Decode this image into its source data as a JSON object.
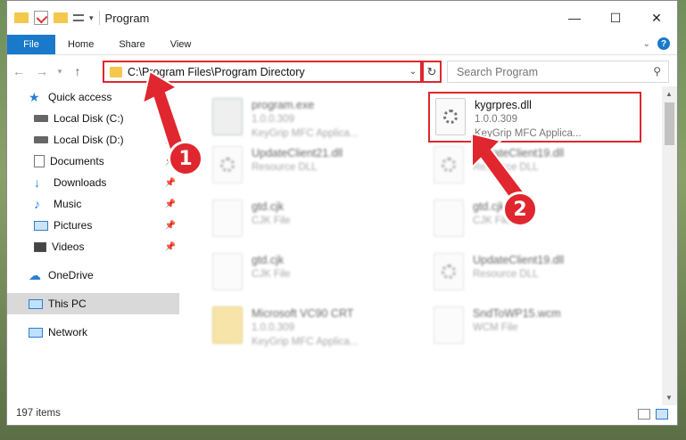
{
  "window": {
    "title": "Program",
    "minimize": "—",
    "maximize": "☐",
    "close": "✕"
  },
  "ribbon": {
    "tabs": [
      "File",
      "Home",
      "Share",
      "View"
    ],
    "help": "?"
  },
  "address": {
    "path": "C:\\Program Files\\Program Directory",
    "search_placeholder": "Search Program"
  },
  "sidebar": {
    "items": [
      {
        "label": "Quick access",
        "icon": "star-icon"
      },
      {
        "label": "Local Disk (C:)",
        "icon": "drive-icon"
      },
      {
        "label": "Local Disk (D:)",
        "icon": "drive-icon"
      },
      {
        "label": "Documents",
        "icon": "documents-icon"
      },
      {
        "label": "Downloads",
        "icon": "download-icon"
      },
      {
        "label": "Music",
        "icon": "music-icon"
      },
      {
        "label": "Pictures",
        "icon": "pictures-icon"
      },
      {
        "label": "Videos",
        "icon": "videos-icon"
      },
      {
        "label": "OneDrive",
        "icon": "cloud-icon"
      },
      {
        "label": "This PC",
        "icon": "computer-icon"
      },
      {
        "label": "Network",
        "icon": "network-icon"
      }
    ]
  },
  "files": [
    {
      "name": "program.exe",
      "line1": "1.0.0.309",
      "line2": "KeyGrip MFC Applica..."
    },
    {
      "name": "kygrpres.dll",
      "line1": "1.0.0.309",
      "line2": "KeyGrip MFC Applica..."
    },
    {
      "name": "UpdateClient21.dll",
      "line1": "Resource DLL",
      "line2": ""
    },
    {
      "name": "UpdateClient19.dll",
      "line1": "Resource DLL",
      "line2": ""
    },
    {
      "name": "gtd.cjk",
      "line1": "CJK File",
      "line2": ""
    },
    {
      "name": "gtd.cjk",
      "line1": "CJK File",
      "line2": ""
    },
    {
      "name": "gtd.cjk",
      "line1": "CJK File",
      "line2": ""
    },
    {
      "name": "UpdateClient19.dll",
      "line1": "Resource DLL",
      "line2": ""
    },
    {
      "name": "Microsoft VC90 CRT",
      "line1": "1.0.0.309",
      "line2": "KeyGrip MFC Applica..."
    },
    {
      "name": "SndToWP15.wcm",
      "line1": "WCM File",
      "line2": ""
    }
  ],
  "status": {
    "count": "197 items"
  },
  "annotations": {
    "step1": "1",
    "step2": "2",
    "color": "#e0262e"
  }
}
